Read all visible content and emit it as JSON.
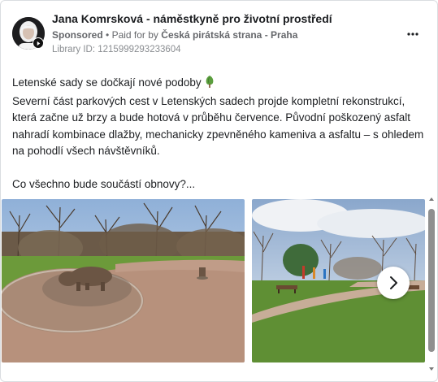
{
  "post": {
    "advertiser": "Jana Komrsková - náměstkyně pro životní prostředí",
    "sponsored_label": "Sponsored",
    "paid_for_prefix": "Paid for by",
    "payer": "Česká pirátská strana - Praha",
    "library_id": "Library ID: 1215999293233604",
    "more_label": "More options",
    "text": {
      "line1": "Letenské sady se dočkají nové podoby",
      "line2": "Severní část parkových cest v Letenských sadech projde kompletní rekonstrukcí, která začne už brzy a bude hotová v průběhu července. Původní poškozený asfalt nahradí kombinace dlažby, mechanicky zpevněného kameniva a asfaltu – s ohledem na pohodlí všech návštěvníků.",
      "line3": "Co všechno bude součástí obnovy?..."
    },
    "emoji": "tree-icon"
  },
  "carousel": {
    "images": [
      {
        "name": "park-path-with-hippo-sculpture"
      },
      {
        "name": "park-lawn-with-playground"
      }
    ],
    "next_icon": "chevron-right-icon"
  },
  "colors": {
    "text": "#1c1e21",
    "secondary": "#65676b",
    "meta": "#8a8d91",
    "border": "#dadde1"
  }
}
